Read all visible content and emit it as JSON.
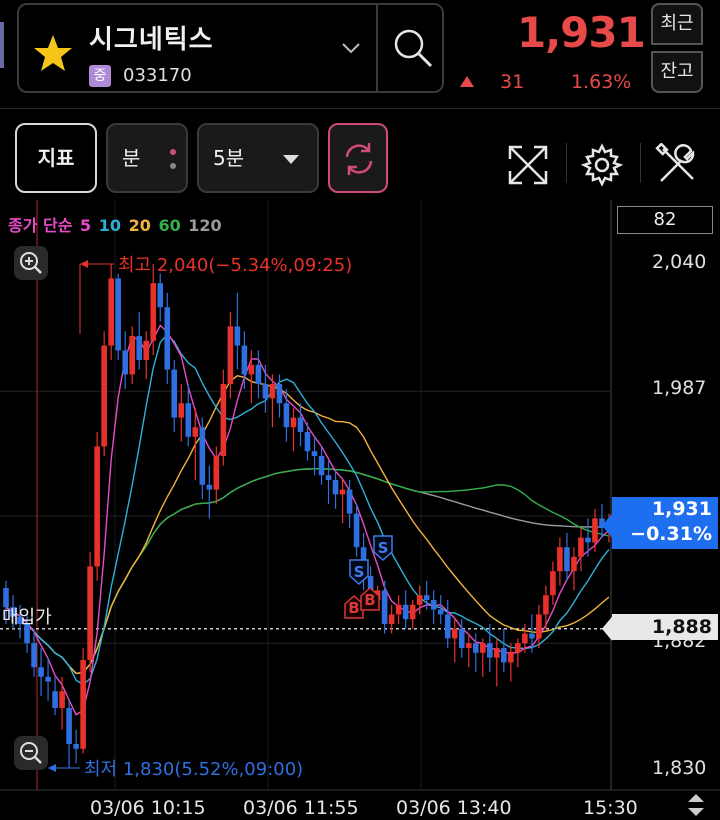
{
  "stock": {
    "name": "시그네틱스",
    "market_badge": "중",
    "code": "033170",
    "price": "1,931",
    "change": "31",
    "change_rate": "1.63%"
  },
  "side_buttons": {
    "recent": "최근",
    "balance": "잔고"
  },
  "toolbar": {
    "indicator_label": "지표",
    "period_label": "분",
    "interval_label": "5분"
  },
  "legend": {
    "prefix": "종가 단순",
    "periods": [
      "5",
      "10",
      "20",
      "60",
      "120"
    ]
  },
  "volume_box": "82",
  "annotations": {
    "high": "최고 2,040(−5.34%,09:25)",
    "low": "최저 1,830(5.52%,09:00)",
    "avg_buy": "매입가"
  },
  "price_tags": {
    "current_price": "1,931",
    "current_rate": "−0.31%",
    "avg_price": "1,888"
  },
  "y_axis": {
    "labels": [
      "2,040",
      "1,987",
      "1,882",
      "1,830"
    ]
  },
  "x_axis": {
    "labels": [
      "03/06 10:15",
      "03/06 11:55",
      "03/06 13:40",
      "15:30"
    ]
  },
  "signals": [
    "B",
    "B",
    "S",
    "S"
  ],
  "colors": {
    "up": "#e8312a",
    "down": "#2f6fe0",
    "ma5": "#e84bc8",
    "ma10": "#2fb0d8",
    "ma20": "#f2b33a",
    "ma60": "#34b04a",
    "ma120": "#9a9a9a",
    "accent": "#1e6ef0"
  },
  "chart_data": {
    "type": "candlestick",
    "y_range": [
      1830,
      2040
    ],
    "high": 2040,
    "low": 1830,
    "current": 1931,
    "avg_buy_price": 1888,
    "candles": [
      [
        1905,
        1908,
        1890,
        1897
      ],
      [
        1897,
        1902,
        1888,
        1893
      ],
      [
        1893,
        1898,
        1884,
        1890
      ],
      [
        1890,
        1894,
        1878,
        1882
      ],
      [
        1882,
        1888,
        1868,
        1872
      ],
      [
        1872,
        1880,
        1860,
        1868
      ],
      [
        1868,
        1876,
        1858,
        1866
      ],
      [
        1862,
        1868,
        1852,
        1855
      ],
      [
        1855,
        1868,
        1846,
        1862
      ],
      [
        1855,
        1858,
        1830,
        1840
      ],
      [
        1840,
        1846,
        1832,
        1838
      ],
      [
        1838,
        1880,
        1836,
        1875
      ],
      [
        1875,
        1920,
        1870,
        1914
      ],
      [
        1914,
        1970,
        1908,
        1964
      ],
      [
        1964,
        2012,
        1960,
        2006
      ],
      [
        2006,
        2040,
        2000,
        2034
      ],
      [
        2034,
        2036,
        2000,
        2004
      ],
      [
        2004,
        2012,
        1988,
        1994
      ],
      [
        1994,
        2014,
        1990,
        2010
      ],
      [
        2010,
        2020,
        1996,
        2000
      ],
      [
        2000,
        2012,
        1992,
        2008
      ],
      [
        2008,
        2040,
        2002,
        2032
      ],
      [
        2032,
        2036,
        2016,
        2022
      ],
      [
        2022,
        2028,
        1990,
        1996
      ],
      [
        1996,
        2000,
        1970,
        1976
      ],
      [
        1976,
        1990,
        1966,
        1982
      ],
      [
        1982,
        1990,
        1964,
        1968
      ],
      [
        1968,
        1980,
        1950,
        1972
      ],
      [
        1972,
        1976,
        1942,
        1948
      ],
      [
        1948,
        1956,
        1934,
        1946
      ],
      [
        1946,
        1964,
        1940,
        1960
      ],
      [
        1960,
        1996,
        1956,
        1990
      ],
      [
        1990,
        2020,
        1984,
        2014
      ],
      [
        2014,
        2028,
        1996,
        2006
      ],
      [
        2006,
        2012,
        1988,
        1994
      ],
      [
        1994,
        2004,
        1982,
        1998
      ],
      [
        1998,
        2004,
        1984,
        1990
      ],
      [
        1990,
        1998,
        1978,
        1984
      ],
      [
        1984,
        1994,
        1972,
        1990
      ],
      [
        1990,
        1994,
        1976,
        1982
      ],
      [
        1982,
        1988,
        1966,
        1972
      ],
      [
        1972,
        1980,
        1962,
        1976
      ],
      [
        1976,
        1982,
        1964,
        1970
      ],
      [
        1970,
        1974,
        1958,
        1962
      ],
      [
        1962,
        1968,
        1952,
        1960
      ],
      [
        1960,
        1964,
        1948,
        1952
      ],
      [
        1952,
        1958,
        1940,
        1950
      ],
      [
        1950,
        1954,
        1938,
        1944
      ],
      [
        1944,
        1950,
        1932,
        1946
      ],
      [
        1946,
        1950,
        1930,
        1936
      ],
      [
        1936,
        1940,
        1918,
        1922
      ],
      [
        1922,
        1928,
        1904,
        1910
      ],
      [
        1910,
        1914,
        1896,
        1900
      ],
      [
        1900,
        1906,
        1898,
        1904
      ],
      [
        1904,
        1908,
        1886,
        1890
      ],
      [
        1890,
        1898,
        1886,
        1894
      ],
      [
        1894,
        1902,
        1890,
        1898
      ],
      [
        1898,
        1904,
        1888,
        1892
      ],
      [
        1892,
        1900,
        1888,
        1898
      ],
      [
        1898,
        1906,
        1894,
        1902
      ],
      [
        1902,
        1908,
        1896,
        1900
      ],
      [
        1900,
        1904,
        1890,
        1896
      ],
      [
        1896,
        1902,
        1890,
        1894
      ],
      [
        1894,
        1900,
        1880,
        1884
      ],
      [
        1884,
        1892,
        1874,
        1888
      ],
      [
        1888,
        1892,
        1876,
        1880
      ],
      [
        1880,
        1886,
        1872,
        1882
      ],
      [
        1882,
        1886,
        1870,
        1878
      ],
      [
        1878,
        1884,
        1868,
        1882
      ],
      [
        1882,
        1890,
        1870,
        1876
      ],
      [
        1876,
        1884,
        1864,
        1880
      ],
      [
        1880,
        1888,
        1870,
        1874
      ],
      [
        1874,
        1882,
        1866,
        1878
      ],
      [
        1878,
        1884,
        1872,
        1882
      ],
      [
        1882,
        1890,
        1878,
        1886
      ],
      [
        1886,
        1894,
        1878,
        1884
      ],
      [
        1884,
        1898,
        1880,
        1894
      ],
      [
        1894,
        1906,
        1888,
        1902
      ],
      [
        1902,
        1916,
        1898,
        1912
      ],
      [
        1912,
        1926,
        1906,
        1922
      ],
      [
        1922,
        1928,
        1908,
        1912
      ],
      [
        1912,
        1922,
        1904,
        1918
      ],
      [
        1918,
        1930,
        1912,
        1926
      ],
      [
        1926,
        1934,
        1918,
        1924
      ],
      [
        1924,
        1938,
        1920,
        1934
      ],
      [
        1934,
        1940,
        1926,
        1930
      ],
      [
        1930,
        1936,
        1924,
        1931
      ]
    ]
  }
}
